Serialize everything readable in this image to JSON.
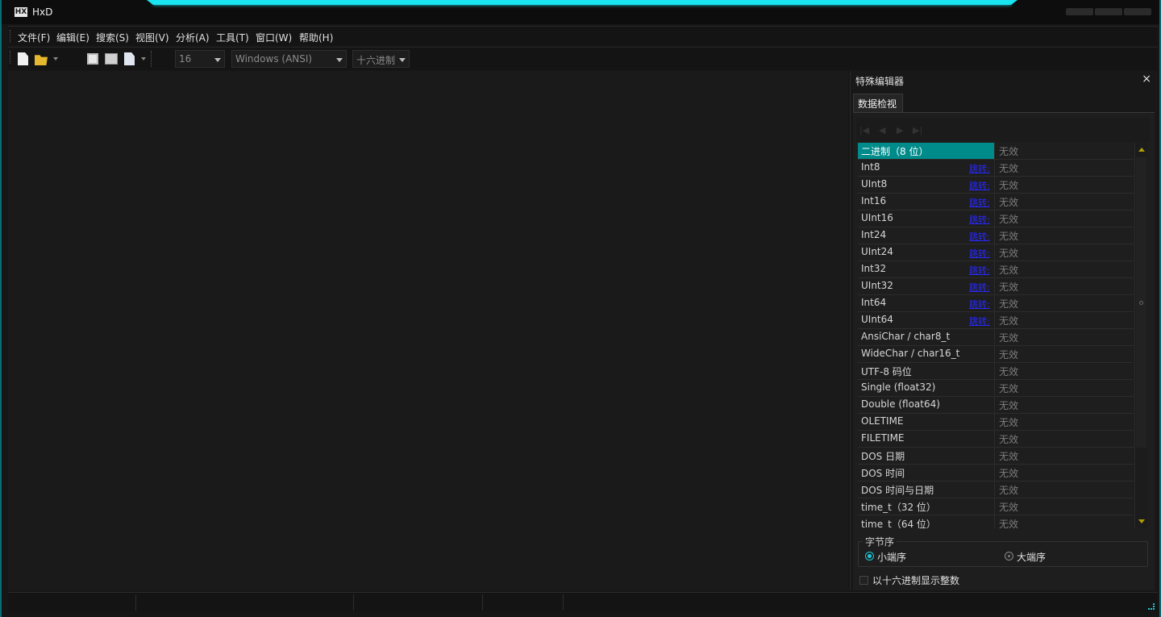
{
  "window": {
    "title": "HxD",
    "icon_text": "HX"
  },
  "menu": [
    {
      "label": "文件(F)"
    },
    {
      "label": "编辑(E)"
    },
    {
      "label": "搜索(S)"
    },
    {
      "label": "视图(V)"
    },
    {
      "label": "分析(A)"
    },
    {
      "label": "工具(T)"
    },
    {
      "label": "窗口(W)"
    },
    {
      "label": "帮助(H)"
    }
  ],
  "toolbar": {
    "bytes_per_row": "16",
    "charset": "Windows (ANSI)",
    "offset_base": "十六进制",
    "icons": [
      "new-file-icon",
      "open-folder-icon",
      "save-icon",
      "save-all-icon",
      "properties-icon"
    ]
  },
  "panel": {
    "title": "特殊编辑器",
    "close": "×",
    "tab": "数据检视",
    "nav": [
      "|◀",
      "◀",
      "▶",
      "▶|"
    ],
    "jump_label": "跳转:",
    "rows": [
      {
        "name": "二进制（8 位）",
        "value": "无效",
        "jump": false,
        "selected": true
      },
      {
        "name": "Int8",
        "value": "无效",
        "jump": true
      },
      {
        "name": "UInt8",
        "value": "无效",
        "jump": true
      },
      {
        "name": "Int16",
        "value": "无效",
        "jump": true
      },
      {
        "name": "UInt16",
        "value": "无效",
        "jump": true
      },
      {
        "name": "Int24",
        "value": "无效",
        "jump": true
      },
      {
        "name": "UInt24",
        "value": "无效",
        "jump": true
      },
      {
        "name": "Int32",
        "value": "无效",
        "jump": true
      },
      {
        "name": "UInt32",
        "value": "无效",
        "jump": true
      },
      {
        "name": "Int64",
        "value": "无效",
        "jump": true
      },
      {
        "name": "UInt64",
        "value": "无效",
        "jump": true
      },
      {
        "name": "AnsiChar / char8_t",
        "value": "无效",
        "jump": false
      },
      {
        "name": "WideChar / char16_t",
        "value": "无效",
        "jump": false
      },
      {
        "name": "UTF-8 码位",
        "value": "无效",
        "jump": false
      },
      {
        "name": "Single (float32)",
        "value": "无效",
        "jump": false
      },
      {
        "name": "Double (float64)",
        "value": "无效",
        "jump": false
      },
      {
        "name": "OLETIME",
        "value": "无效",
        "jump": false
      },
      {
        "name": "FILETIME",
        "value": "无效",
        "jump": false
      },
      {
        "name": "DOS 日期",
        "value": "无效",
        "jump": false
      },
      {
        "name": "DOS 时间",
        "value": "无效",
        "jump": false
      },
      {
        "name": "DOS 时间与日期",
        "value": "无效",
        "jump": false
      },
      {
        "name": "time_t（32 位）",
        "value": "无效",
        "jump": false
      },
      {
        "name": "time_t（64 位）",
        "value": "无效",
        "jump": false
      }
    ],
    "byte_order": {
      "label": "字节序",
      "little": "小端序",
      "big": "大端序",
      "selected": "little"
    },
    "hex_ints_label": "以十六进制显示整数",
    "hex_ints_checked": false
  },
  "colors": {
    "accent": "#19e4ef",
    "selection": "#008b8b",
    "link": "#2929ff"
  }
}
